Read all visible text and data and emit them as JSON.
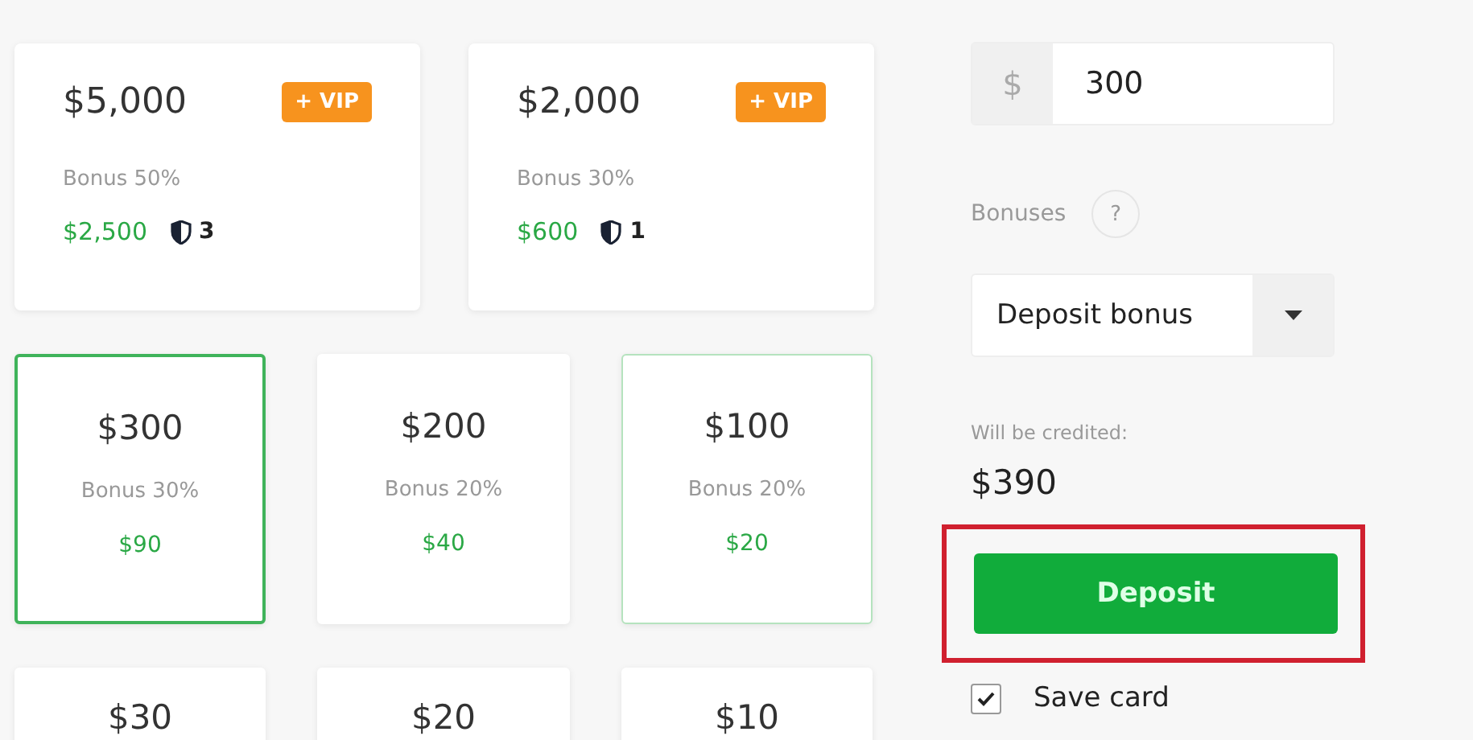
{
  "vip_packages": [
    {
      "amount": "$5,000",
      "badge": "+ VIP",
      "bonus": "Bonus 50%",
      "bonus_amount": "$2,500",
      "shield_count": "3"
    },
    {
      "amount": "$2,000",
      "badge": "+ VIP",
      "bonus": "Bonus 30%",
      "bonus_amount": "$600",
      "shield_count": "1"
    }
  ],
  "packages": [
    {
      "amount": "$300",
      "bonus": "Bonus 30%",
      "bonus_amount": "$90",
      "selected": true,
      "hovered": false
    },
    {
      "amount": "$200",
      "bonus": "Bonus 20%",
      "bonus_amount": "$40",
      "selected": false,
      "hovered": false
    },
    {
      "amount": "$100",
      "bonus": "Bonus 20%",
      "bonus_amount": "$20",
      "selected": false,
      "hovered": true
    },
    {
      "amount": "$30",
      "selected": false,
      "hovered": false
    },
    {
      "amount": "$20",
      "selected": false,
      "hovered": false
    },
    {
      "amount": "$10",
      "selected": false,
      "hovered": false
    }
  ],
  "amount_field": {
    "currency": "$",
    "value": "300"
  },
  "bonuses": {
    "label": "Bonuses",
    "help": "?",
    "selected": "Deposit bonus"
  },
  "credited": {
    "label": "Will be credited:",
    "value": "$390"
  },
  "deposit_button": {
    "label": "Deposit",
    "highlighted": true
  },
  "save_card": {
    "label": "Save card",
    "checked": true
  }
}
